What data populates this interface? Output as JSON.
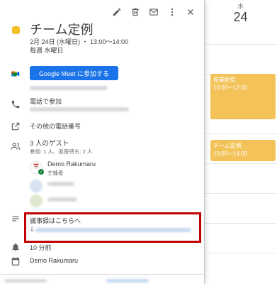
{
  "calendar": {
    "weekday": "水",
    "day_number": "24",
    "events": [
      {
        "title": "授業配信",
        "time": "10:00～12:00"
      },
      {
        "title": "チーム定例",
        "time": "13:00～14:00"
      }
    ]
  },
  "event": {
    "color": "#f6bf26",
    "title": "チーム定例",
    "datetime": "2月 24日 (水曜日) ・ 13:00～14:00",
    "recurrence": "毎週 水曜日",
    "meet_button": "Google Meet に参加する",
    "phone_join": "電話で参加",
    "more_phones": "その他の電話番号",
    "guests_title": "3 人のゲスト",
    "guests_summary": "参加: 1 人、返答待ち: 2 人",
    "organizer_name": "Demo Rakumaru",
    "organizer_role": "主催者",
    "description_title": "議事録はこちらへ",
    "description_arrow": "⇩",
    "reminder": "10 分前",
    "calendar_owner": "Demo Rakumaru"
  },
  "toolbar": {
    "edit_icon": "pencil-icon",
    "delete_icon": "trash-icon",
    "email_icon": "mail-icon",
    "more_icon": "more-vert-icon",
    "close_icon": "close-icon"
  }
}
